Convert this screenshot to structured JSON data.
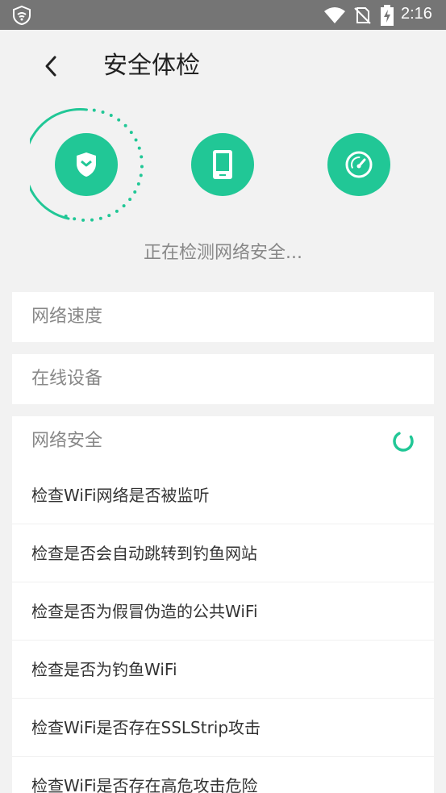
{
  "status_bar": {
    "time": "2:16",
    "icons": [
      "app-shield-icon",
      "wifi-icon",
      "no-sim-icon",
      "battery-charging-icon"
    ]
  },
  "header": {
    "title": "安全体检",
    "back_icon": "chevron-left-icon"
  },
  "steps": [
    {
      "icon": "shield-icon",
      "active": true
    },
    {
      "icon": "phone-icon",
      "active": false
    },
    {
      "icon": "speedometer-icon",
      "active": false
    }
  ],
  "status_text": "正在检测网络安全...",
  "sections": {
    "speed": {
      "title": "网络速度"
    },
    "devices": {
      "title": "在线设备"
    },
    "security": {
      "title": "网络安全",
      "items": [
        "检查WiFi网络是否被监听",
        "检查是否会自动跳转到钓鱼网站",
        "检查是否为假冒伪造的公共WiFi",
        "检查是否为钓鱼WiFi",
        "检查WiFi是否存在SSLStrip攻击",
        "检查WiFi是否存在高危攻击危险"
      ]
    }
  },
  "colors": {
    "accent": "#21c796",
    "status_bar": "#757575",
    "background": "#f2f2f2"
  }
}
